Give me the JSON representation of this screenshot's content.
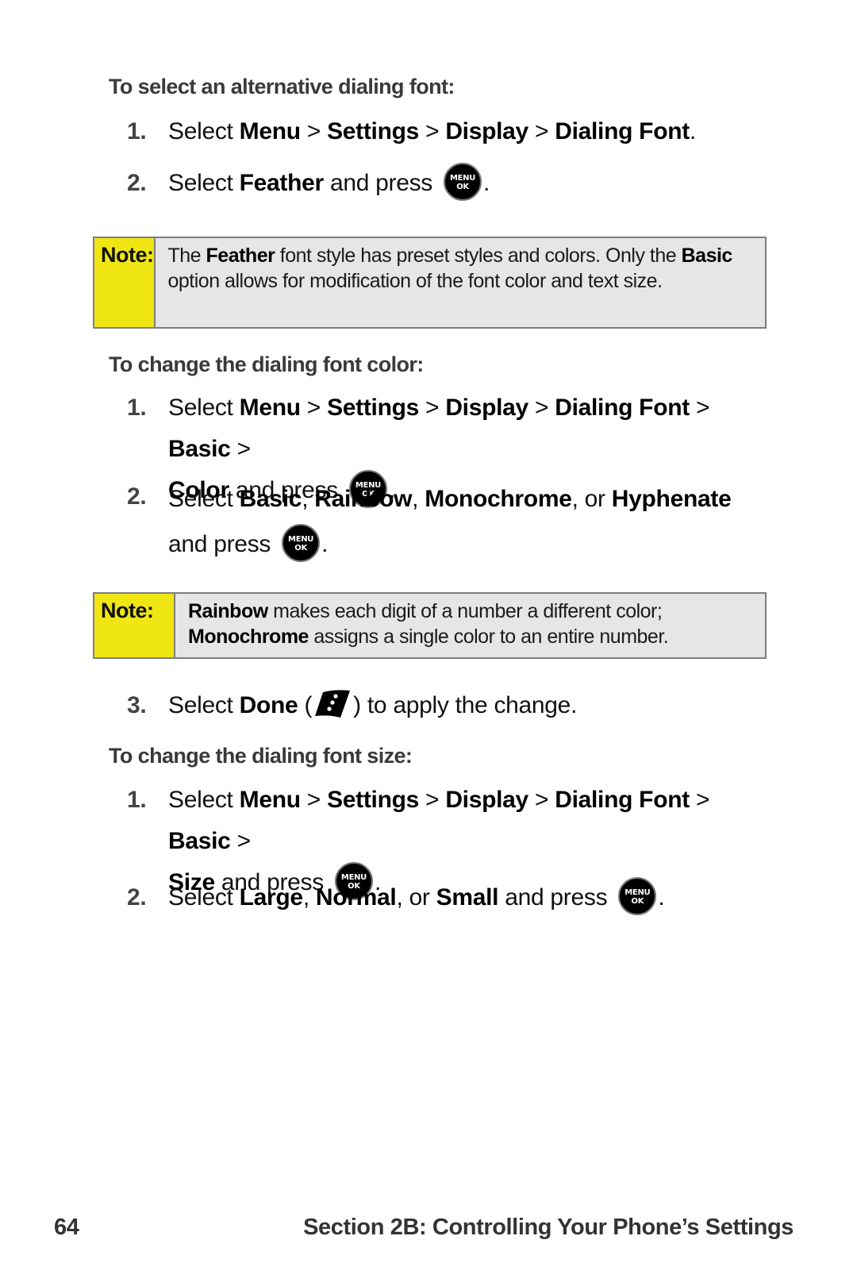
{
  "section1": {
    "heading": "To select an alternative dialing font:",
    "steps": [
      {
        "num": "1.",
        "select": "Select ",
        "path": [
          "Menu",
          "Settings",
          "Display",
          "Dialing Font"
        ],
        "sep": " > ",
        "end": "."
      },
      {
        "num": "2.",
        "select": "Select ",
        "option": "Feather",
        "press": " and press ",
        "end": "."
      }
    ]
  },
  "note1": {
    "label": "Note:",
    "t1": "The ",
    "b1": "Feather",
    "t2": " font style has preset styles and colors. Only the ",
    "b2": "Basic",
    "t3": " option allows for modification of the font color and text size."
  },
  "section2": {
    "heading": "To change the dialing font color:",
    "steps": [
      {
        "num": "1.",
        "select": "Select ",
        "path": [
          "Menu",
          "Settings",
          "Display",
          "Dialing Font",
          "Basic",
          "Color"
        ],
        "sep": " > ",
        "press": " and press ",
        "end": "."
      },
      {
        "num": "2.",
        "select": "Select ",
        "options": [
          "Basic",
          "Rainbow",
          "Monochrome",
          "Hyphenate"
        ],
        "comma": ", ",
        "or": ", or ",
        "press": " and press ",
        "end": "."
      },
      {
        "num": "3.",
        "select": "Select ",
        "option": "Done",
        "open": " (",
        "close": ") to apply the change."
      }
    ]
  },
  "note2": {
    "label": "Note:",
    "b1": "Rainbow",
    "t1": " makes each digit of a number a different color;",
    "b2": "Monochrome",
    "t2": " assigns a single color to an entire number."
  },
  "section3": {
    "heading": "To change the dialing font size:",
    "steps": [
      {
        "num": "1.",
        "select": "Select ",
        "path": [
          "Menu",
          "Settings",
          "Display",
          "Dialing Font",
          "Basic",
          "Size"
        ],
        "sep": " > ",
        "press": " and press ",
        "end": "."
      },
      {
        "num": "2.",
        "select": "Select ",
        "options": [
          "Large",
          "Normal",
          "Small"
        ],
        "comma": ", ",
        "or": ", or ",
        "press": " and press ",
        "end": "."
      }
    ]
  },
  "key": {
    "line1": "MENU",
    "line2": "OK"
  },
  "icons": {
    "menu_ok": "menu-ok-key-icon",
    "done": "done-softkey-icon"
  },
  "footer": {
    "page_number": "64",
    "section_title": "Section 2B: Controlling Your Phone’s Settings"
  },
  "colors": {
    "note_label_bg": "#f0e614",
    "note_bg": "#e6e6e6",
    "note_border": "#7d7d7d",
    "heading": "#3a3a3a"
  }
}
